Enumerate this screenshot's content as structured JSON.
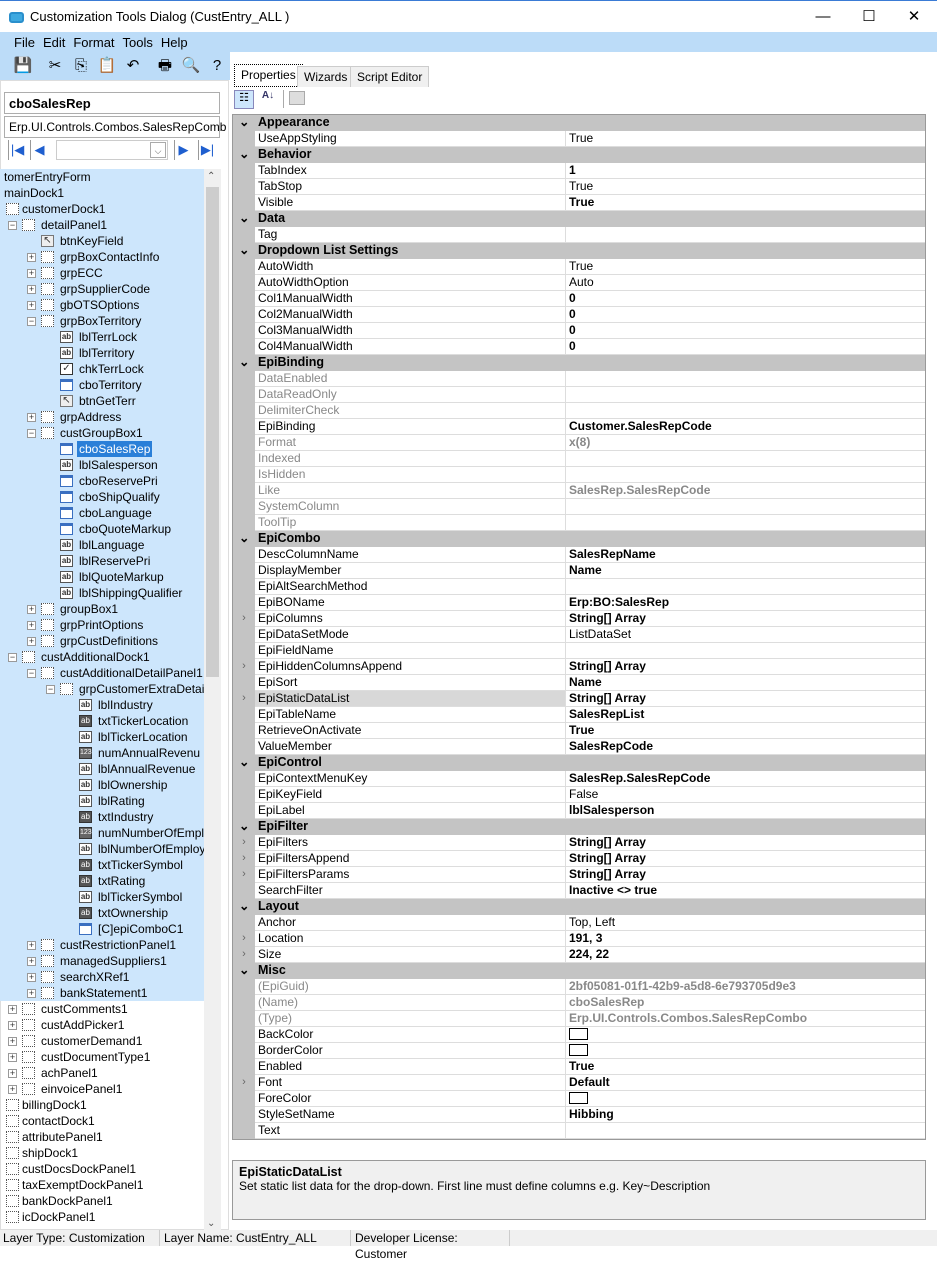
{
  "window": {
    "title": "Customization Tools Dialog  (CustEntry_ALL )",
    "minimize": "—",
    "maximize": "☐",
    "close": "✕"
  },
  "menu": [
    "File",
    "Edit",
    "Format",
    "Tools",
    "Help"
  ],
  "toolbar": [
    {
      "icon": "save-icon",
      "glyph": "💾"
    },
    {
      "icon": "cut-icon",
      "glyph": "✂"
    },
    {
      "icon": "copy-icon",
      "glyph": "⎘"
    },
    {
      "icon": "paste-icon",
      "glyph": "📋"
    },
    {
      "icon": "undo-icon",
      "glyph": "↶"
    },
    {
      "icon": "print-icon",
      "glyph": "🖶"
    },
    {
      "icon": "print-preview-icon",
      "glyph": "🔍"
    },
    {
      "icon": "help-icon",
      "glyph": "?"
    }
  ],
  "left": {
    "control_name": "cboSalesRep",
    "control_type": "Erp.UI.Controls.Combos.SalesRepComb"
  },
  "tree": [
    {
      "t": "tomerEntryForm",
      "l": -1,
      "i": "",
      "e": ""
    },
    {
      "t": "mainDock1",
      "l": -1,
      "i": "",
      "e": ""
    },
    {
      "t": "customerDock1",
      "l": 0,
      "i": "panel",
      "e": ""
    },
    {
      "t": "detailPanel1",
      "l": 1,
      "i": "panel",
      "e": "-"
    },
    {
      "t": "btnKeyField",
      "l": 2,
      "i": "btn",
      "e": ""
    },
    {
      "t": "grpBoxContactInfo",
      "l": 2,
      "i": "grp",
      "e": "+"
    },
    {
      "t": "grpECC",
      "l": 2,
      "i": "grp",
      "e": "+"
    },
    {
      "t": "grpSupplierCode",
      "l": 2,
      "i": "grp",
      "e": "+"
    },
    {
      "t": "gbOTSOptions",
      "l": 2,
      "i": "grp",
      "e": "+"
    },
    {
      "t": "grpBoxTerritory",
      "l": 2,
      "i": "grp",
      "e": "-"
    },
    {
      "t": "lblTerrLock",
      "l": 3,
      "i": "lbl",
      "e": ""
    },
    {
      "t": "lblTerritory",
      "l": 3,
      "i": "lbl",
      "e": ""
    },
    {
      "t": "chkTerrLock",
      "l": 3,
      "i": "chk",
      "e": ""
    },
    {
      "t": "cboTerritory",
      "l": 3,
      "i": "cbo",
      "e": ""
    },
    {
      "t": "btnGetTerr",
      "l": 3,
      "i": "btn",
      "e": ""
    },
    {
      "t": "grpAddress",
      "l": 2,
      "i": "grp",
      "e": "+"
    },
    {
      "t": "custGroupBox1",
      "l": 2,
      "i": "grp",
      "e": "-"
    },
    {
      "t": "cboSalesRep",
      "l": 3,
      "i": "cbo",
      "e": "",
      "sel": true
    },
    {
      "t": "lblSalesperson",
      "l": 3,
      "i": "lbl",
      "e": ""
    },
    {
      "t": "cboReservePri",
      "l": 3,
      "i": "cbo",
      "e": ""
    },
    {
      "t": "cboShipQualify",
      "l": 3,
      "i": "cbo",
      "e": ""
    },
    {
      "t": "cboLanguage",
      "l": 3,
      "i": "cbo",
      "e": ""
    },
    {
      "t": "cboQuoteMarkup",
      "l": 3,
      "i": "cbo",
      "e": ""
    },
    {
      "t": "lblLanguage",
      "l": 3,
      "i": "lbl",
      "e": ""
    },
    {
      "t": "lblReservePri",
      "l": 3,
      "i": "lbl",
      "e": ""
    },
    {
      "t": "lblQuoteMarkup",
      "l": 3,
      "i": "lbl",
      "e": ""
    },
    {
      "t": "lblShippingQualifier",
      "l": 3,
      "i": "lbl",
      "e": ""
    },
    {
      "t": "groupBox1",
      "l": 2,
      "i": "grp",
      "e": "+"
    },
    {
      "t": "grpPrintOptions",
      "l": 2,
      "i": "grp",
      "e": "+"
    },
    {
      "t": "grpCustDefinitions",
      "l": 2,
      "i": "grp",
      "e": "+"
    },
    {
      "t": "custAdditionalDock1",
      "l": 1,
      "i": "panel",
      "e": "-"
    },
    {
      "t": "custAdditionalDetailPanel1",
      "l": 2,
      "i": "panel",
      "e": "-"
    },
    {
      "t": "grpCustomerExtraDetail",
      "l": 3,
      "i": "grp",
      "e": "-"
    },
    {
      "t": "lblIndustry",
      "l": 4,
      "i": "lbl",
      "e": ""
    },
    {
      "t": "txtTickerLocation",
      "l": 4,
      "i": "txt",
      "e": ""
    },
    {
      "t": "lblTickerLocation",
      "l": 4,
      "i": "lbl",
      "e": ""
    },
    {
      "t": "numAnnualRevenu",
      "l": 4,
      "i": "num",
      "e": ""
    },
    {
      "t": "lblAnnualRevenue",
      "l": 4,
      "i": "lbl",
      "e": ""
    },
    {
      "t": "lblOwnership",
      "l": 4,
      "i": "lbl",
      "e": ""
    },
    {
      "t": "lblRating",
      "l": 4,
      "i": "lbl",
      "e": ""
    },
    {
      "t": "txtIndustry",
      "l": 4,
      "i": "txt",
      "e": ""
    },
    {
      "t": "numNumberOfEmpl",
      "l": 4,
      "i": "num",
      "e": ""
    },
    {
      "t": "lblNumberOfEmploy",
      "l": 4,
      "i": "lbl",
      "e": ""
    },
    {
      "t": "txtTickerSymbol",
      "l": 4,
      "i": "txt",
      "e": ""
    },
    {
      "t": "txtRating",
      "l": 4,
      "i": "txt",
      "e": ""
    },
    {
      "t": "lblTickerSymbol",
      "l": 4,
      "i": "lbl",
      "e": ""
    },
    {
      "t": "txtOwnership",
      "l": 4,
      "i": "txt",
      "e": ""
    },
    {
      "t": "[C]epiComboC1",
      "l": 4,
      "i": "cbo",
      "e": ""
    },
    {
      "t": "custRestrictionPanel1",
      "l": 2,
      "i": "panel",
      "e": "+"
    },
    {
      "t": "managedSuppliers1",
      "l": 2,
      "i": "panel",
      "e": "+"
    },
    {
      "t": "searchXRef1",
      "l": 2,
      "i": "panel",
      "e": "+"
    },
    {
      "t": "bankStatement1",
      "l": 2,
      "i": "panel",
      "e": "+"
    },
    {
      "t": "custComments1",
      "l": 1,
      "i": "panel",
      "e": "+"
    },
    {
      "t": "custAddPicker1",
      "l": 1,
      "i": "panel",
      "e": "+"
    },
    {
      "t": "customerDemand1",
      "l": 1,
      "i": "panel",
      "e": "+"
    },
    {
      "t": "custDocumentType1",
      "l": 1,
      "i": "panel",
      "e": "+"
    },
    {
      "t": "achPanel1",
      "l": 1,
      "i": "panel",
      "e": "+"
    },
    {
      "t": "einvoicePanel1",
      "l": 1,
      "i": "panel",
      "e": "+"
    },
    {
      "t": "billingDock1",
      "l": 0,
      "i": "panel",
      "e": ""
    },
    {
      "t": "contactDock1",
      "l": 0,
      "i": "panel",
      "e": ""
    },
    {
      "t": "attributePanel1",
      "l": 0,
      "i": "panel",
      "e": ""
    },
    {
      "t": "shipDock1",
      "l": 0,
      "i": "panel",
      "e": ""
    },
    {
      "t": "custDocsDockPanel1",
      "l": 0,
      "i": "panel",
      "e": ""
    },
    {
      "t": "taxExemptDockPanel1",
      "l": 0,
      "i": "panel",
      "e": ""
    },
    {
      "t": "bankDockPanel1",
      "l": 0,
      "i": "panel",
      "e": ""
    },
    {
      "t": "icDockPanel1",
      "l": 0,
      "i": "panel",
      "e": ""
    }
  ],
  "tabs": [
    "Properties",
    "Wizards",
    "Script Editor"
  ],
  "properties": [
    {
      "cat": "Appearance"
    },
    {
      "n": "UseAppStyling",
      "v": "True"
    },
    {
      "cat": "Behavior"
    },
    {
      "n": "TabIndex",
      "v": "1",
      "b": 1
    },
    {
      "n": "TabStop",
      "v": "True"
    },
    {
      "n": "Visible",
      "v": "True",
      "b": 1
    },
    {
      "cat": "Data"
    },
    {
      "n": "Tag",
      "v": ""
    },
    {
      "cat": "Dropdown List Settings"
    },
    {
      "n": "AutoWidth",
      "v": "True"
    },
    {
      "n": "AutoWidthOption",
      "v": "Auto"
    },
    {
      "n": "Col1ManualWidth",
      "v": "0",
      "b": 1
    },
    {
      "n": "Col2ManualWidth",
      "v": "0",
      "b": 1
    },
    {
      "n": "Col3ManualWidth",
      "v": "0",
      "b": 1
    },
    {
      "n": "Col4ManualWidth",
      "v": "0",
      "b": 1
    },
    {
      "cat": "EpiBinding"
    },
    {
      "n": "DataEnabled",
      "v": "",
      "d": 1
    },
    {
      "n": "DataReadOnly",
      "v": "",
      "d": 1
    },
    {
      "n": "DelimiterCheck",
      "v": "",
      "d": 1
    },
    {
      "n": "EpiBinding",
      "v": "Customer.SalesRepCode",
      "b": 1
    },
    {
      "n": "Format",
      "v": "x(8)",
      "b": 1,
      "d": 1
    },
    {
      "n": "Indexed",
      "v": "",
      "d": 1
    },
    {
      "n": "IsHidden",
      "v": "",
      "d": 1
    },
    {
      "n": "Like",
      "v": "SalesRep.SalesRepCode",
      "b": 1,
      "d": 1
    },
    {
      "n": "SystemColumn",
      "v": "",
      "d": 1
    },
    {
      "n": "ToolTip",
      "v": "",
      "d": 1
    },
    {
      "cat": "EpiCombo"
    },
    {
      "n": "DescColumnName",
      "v": "SalesRepName",
      "b": 1
    },
    {
      "n": "DisplayMember",
      "v": "Name",
      "b": 1
    },
    {
      "n": "EpiAltSearchMethod",
      "v": ""
    },
    {
      "n": "EpiBOName",
      "v": "Erp:BO:SalesRep",
      "b": 1
    },
    {
      "n": "EpiColumns",
      "v": "String[] Array",
      "b": 1,
      "x": 1
    },
    {
      "n": "EpiDataSetMode",
      "v": "ListDataSet"
    },
    {
      "n": "EpiFieldName",
      "v": ""
    },
    {
      "n": "EpiHiddenColumnsAppend",
      "v": "String[] Array",
      "b": 1,
      "x": 1
    },
    {
      "n": "EpiSort",
      "v": "Name",
      "b": 1
    },
    {
      "n": "EpiStaticDataList",
      "v": "String[] Array",
      "b": 1,
      "x": 1,
      "hl": 1
    },
    {
      "n": "EpiTableName",
      "v": "SalesRepList",
      "b": 1
    },
    {
      "n": "RetrieveOnActivate",
      "v": "True",
      "b": 1
    },
    {
      "n": "ValueMember",
      "v": "SalesRepCode",
      "b": 1
    },
    {
      "cat": "EpiControl"
    },
    {
      "n": "EpiContextMenuKey",
      "v": "SalesRep.SalesRepCode",
      "b": 1
    },
    {
      "n": "EpiKeyField",
      "v": "False"
    },
    {
      "n": "EpiLabel",
      "v": "lblSalesperson",
      "b": 1
    },
    {
      "cat": "EpiFilter"
    },
    {
      "n": "EpiFilters",
      "v": "String[] Array",
      "b": 1,
      "x": 1
    },
    {
      "n": "EpiFiltersAppend",
      "v": "String[] Array",
      "b": 1,
      "x": 1
    },
    {
      "n": "EpiFiltersParams",
      "v": "String[] Array",
      "b": 1,
      "x": 1
    },
    {
      "n": "SearchFilter",
      "v": "Inactive <> true",
      "b": 1
    },
    {
      "cat": "Layout"
    },
    {
      "n": "Anchor",
      "v": "Top, Left"
    },
    {
      "n": "Location",
      "v": "191, 3",
      "b": 1,
      "x": 1
    },
    {
      "n": "Size",
      "v": "224, 22",
      "b": 1,
      "x": 1
    },
    {
      "cat": "Misc"
    },
    {
      "n": "(EpiGuid)",
      "v": "2bf05081-01f1-42b9-a5d8-6e793705d9e3",
      "b": 1,
      "d": 1
    },
    {
      "n": "(Name)",
      "v": "cboSalesRep",
      "b": 1,
      "d": 1
    },
    {
      "n": "(Type)",
      "v": "Erp.UI.Controls.Combos.SalesRepCombo",
      "b": 1,
      "d": 1
    },
    {
      "n": "BackColor",
      "v": "",
      "sw": 1
    },
    {
      "n": "BorderColor",
      "v": "",
      "sw": 1
    },
    {
      "n": "Enabled",
      "v": "True",
      "b": 1
    },
    {
      "n": "Font",
      "v": "Default",
      "b": 1,
      "x": 1
    },
    {
      "n": "ForeColor",
      "v": "",
      "sw": 1
    },
    {
      "n": "StyleSetName",
      "v": "Hibbing",
      "b": 1
    },
    {
      "n": "Text",
      "v": ""
    }
  ],
  "description": {
    "title": "EpiStaticDataList",
    "text": "Set static list data for the drop-down. First line must define columns e.g. Key~Description"
  },
  "status": {
    "layer_type": "Layer Type:  Customization",
    "layer_name": "Layer Name:  CustEntry_ALL",
    "license": "Developer License:  Customer"
  }
}
